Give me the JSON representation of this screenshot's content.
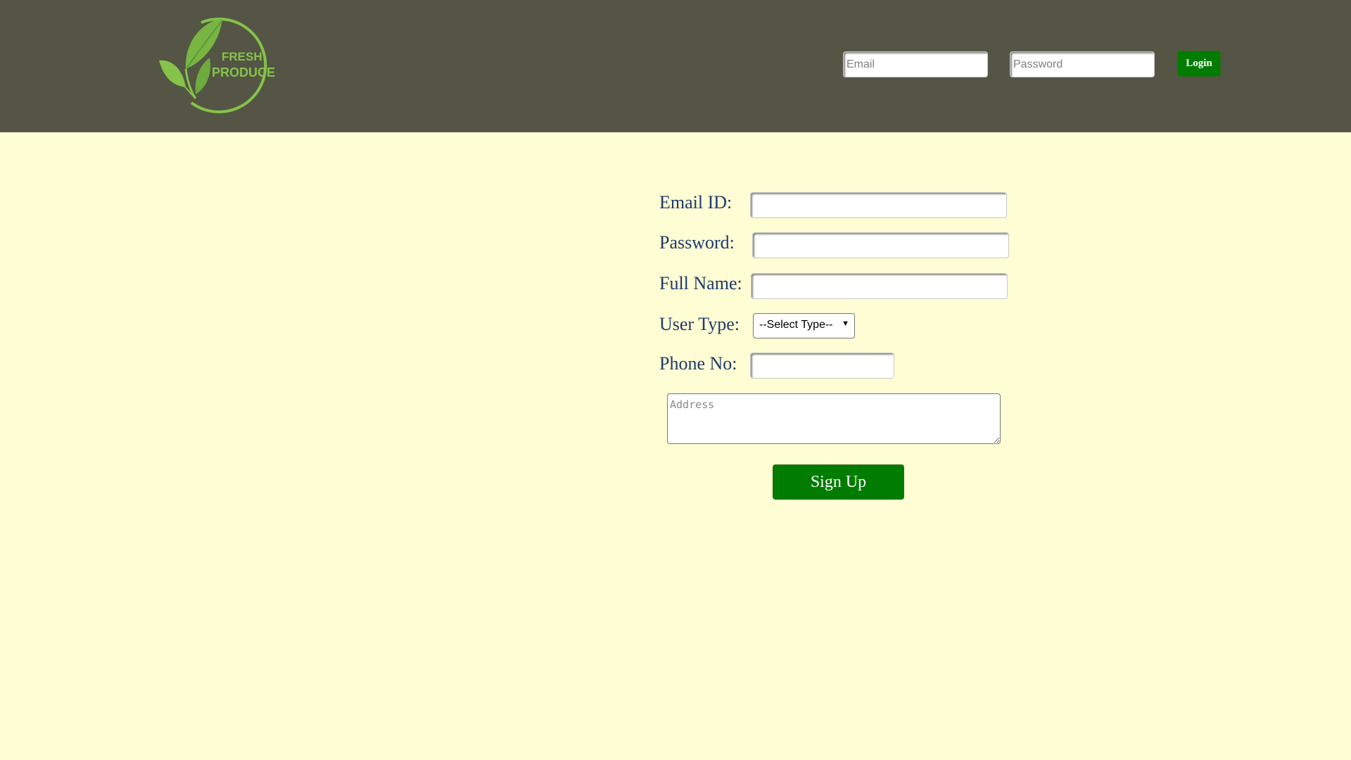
{
  "logo": {
    "line1": "FRESH",
    "line2": "PRODUCE",
    "icon": "leaf-circle-logo",
    "color": "#86c34a"
  },
  "header": {
    "background": "#545544",
    "email_placeholder": "Email",
    "password_placeholder": "Password",
    "login_label": "Login"
  },
  "form": {
    "email_label": "Email ID:",
    "password_label": "Password:",
    "fullname_label": "Full Name:",
    "usertype_label": "User Type:",
    "usertype_value": "--Select Type--",
    "usertype_arrow_icon": "caret-down-icon",
    "phone_label": "Phone No:",
    "address_placeholder": "Address",
    "signup_label": "Sign Up"
  },
  "colors": {
    "page_background": "#fffdd4",
    "button_green": "#007d00",
    "label_color": "#1f3a6b"
  }
}
